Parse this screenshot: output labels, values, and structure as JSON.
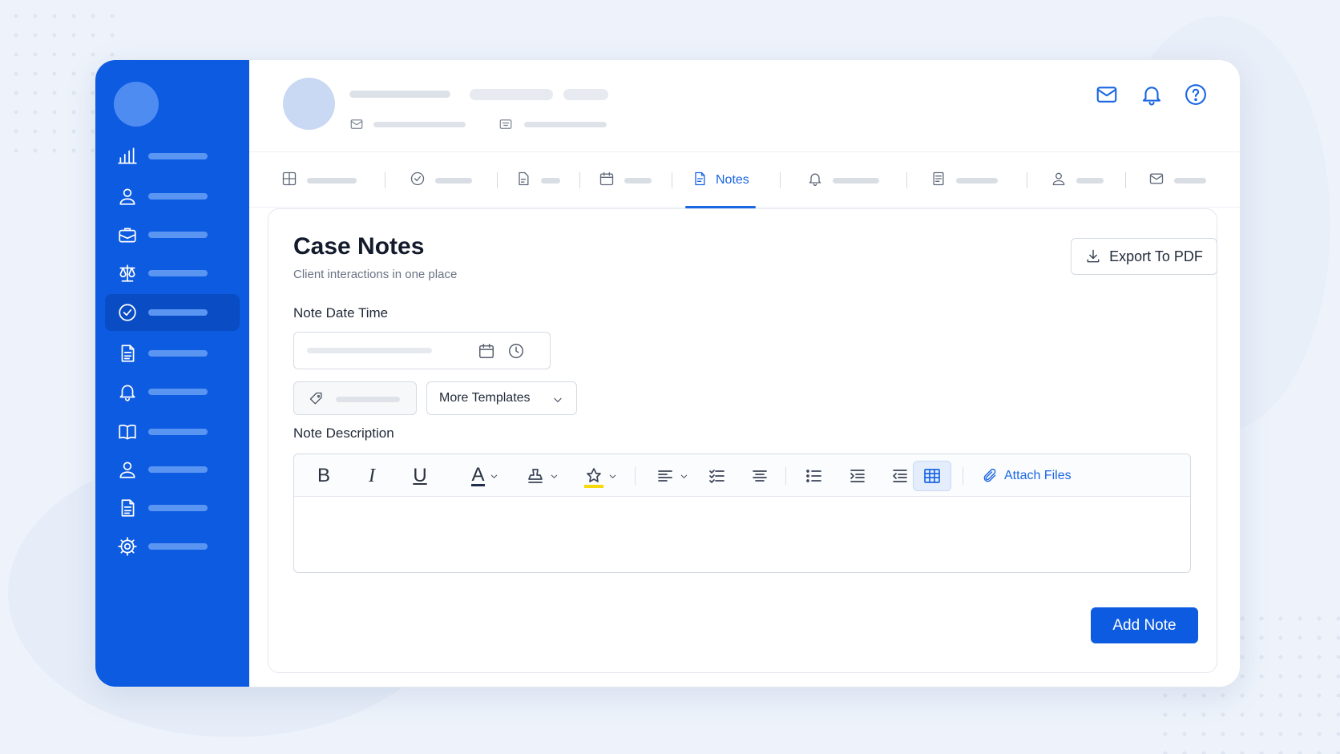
{
  "tabs": {
    "active_label": "Notes"
  },
  "panel": {
    "title": "Case Notes",
    "subtitle": "Client interactions in one place",
    "export_label": "Export To PDF",
    "date_label": "Note Date Time",
    "templates_label": "More Templates",
    "description_label": "Note Description",
    "attach_label": "Attach Files",
    "add_label": "Add Note"
  },
  "toolbar": {
    "bold": "B",
    "italic": "I",
    "underline": "U",
    "font_color": "A"
  },
  "colors": {
    "brand": "#0d5be1",
    "accent": "#1a66e3",
    "highlight": "#f5d90a"
  }
}
